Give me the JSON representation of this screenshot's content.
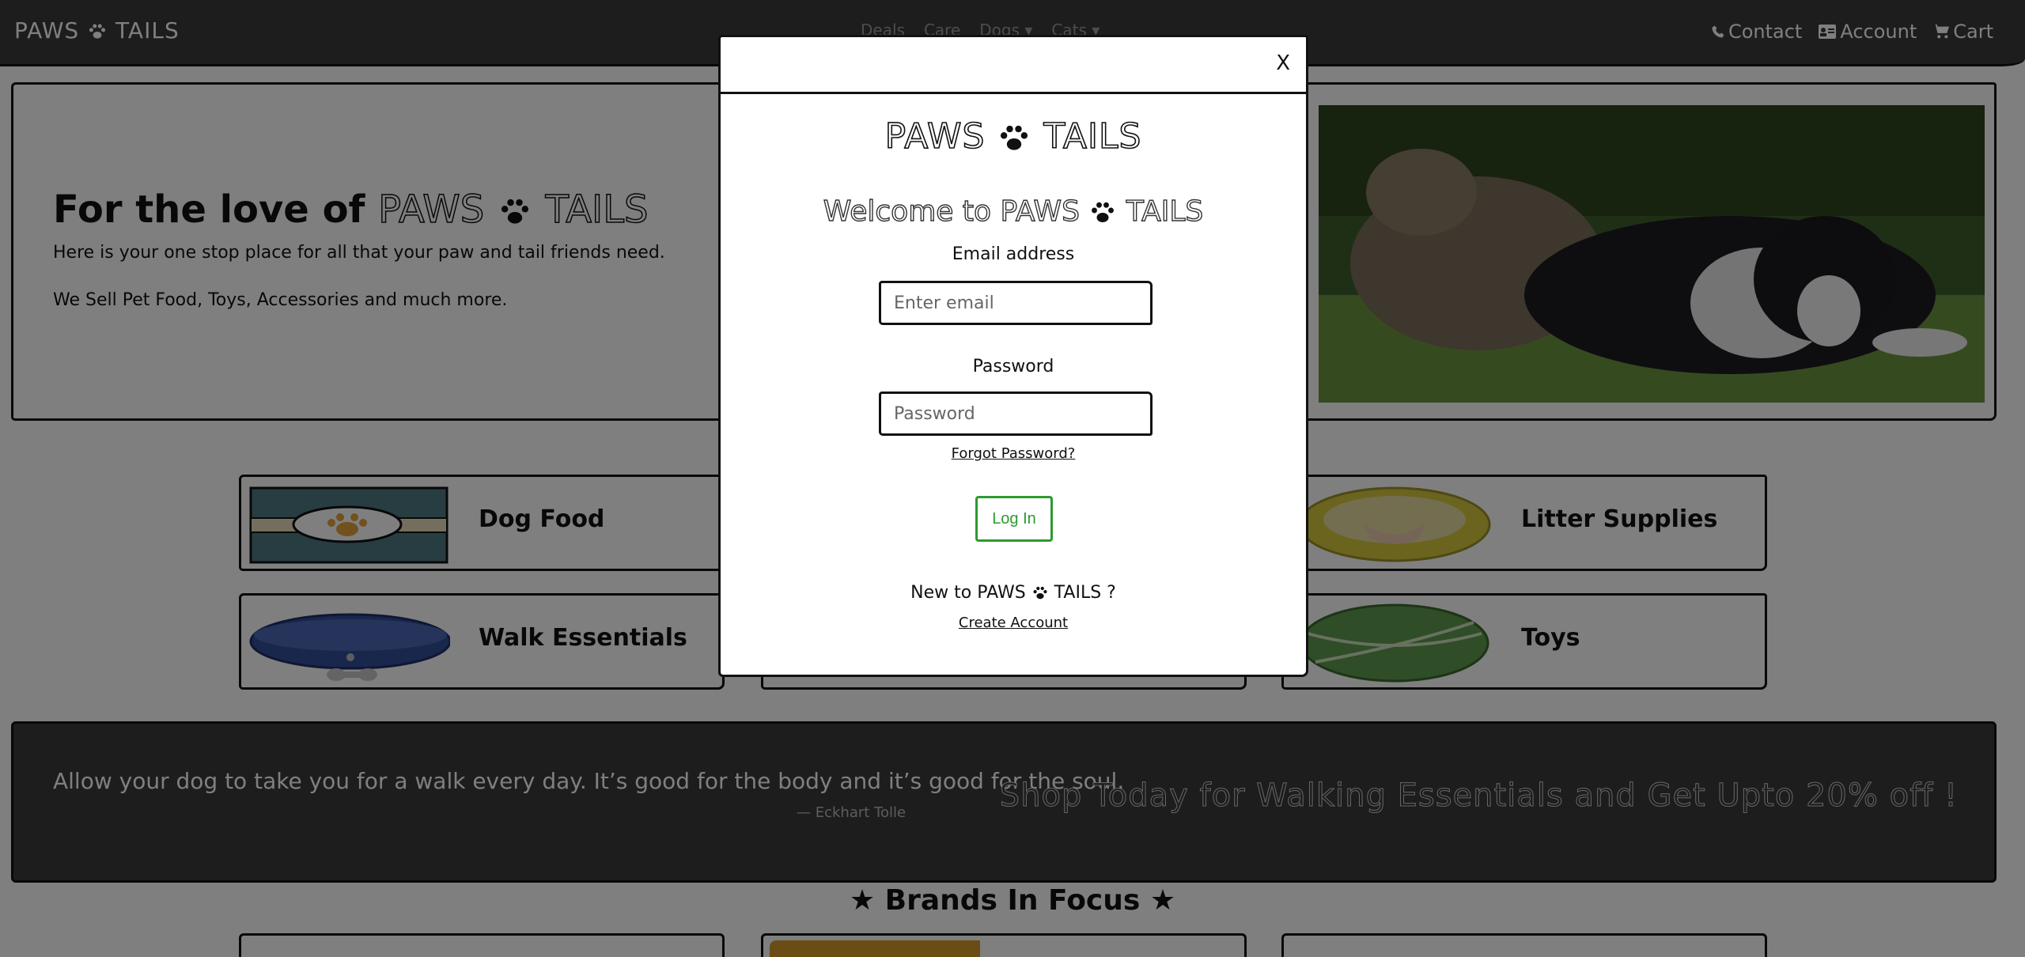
{
  "navbar": {
    "brand_left": "PAWS",
    "brand_right": "TAILS",
    "links": [
      "Deals",
      "Care",
      "Dogs ▾",
      "Cats ▾"
    ],
    "right_links": [
      {
        "label": "Contact",
        "icon": "phone-icon"
      },
      {
        "label": "Account",
        "icon": "account-card-icon"
      },
      {
        "label": "Cart",
        "icon": "cart-icon"
      }
    ]
  },
  "hero": {
    "title_prefix": "For the love of",
    "brand_left": "PAWS",
    "brand_right": "TAILS",
    "line1": "Here is your one stop place for all that your paw and tail friends need.",
    "line2": "We Sell Pet Food, Toys, Accessories and much more."
  },
  "categories": [
    {
      "label": "Dog Food"
    },
    {
      "label": "Litter Supplies"
    },
    {
      "label": "Walk Essentials"
    },
    {
      "label": "Toys"
    }
  ],
  "banner": {
    "quote": "Allow your dog to take you for a walk every day. It’s good for the body and it’s good for the soul.",
    "author": "— Eckhart Tolle",
    "promo": "Shop Today for Walking Essentials and Get Upto 20% off !"
  },
  "brands": {
    "title": "Brands In Focus"
  },
  "modal": {
    "close": "X",
    "logo_left": "PAWS",
    "logo_right": "TAILS",
    "welcome_prefix": "Welcome to",
    "welcome_left": "PAWS",
    "welcome_right": "TAILS",
    "email_label": "Email address",
    "email_placeholder": "Enter email",
    "password_label": "Password",
    "password_placeholder": "Password",
    "forgot": "Forgot Password?",
    "login": "Log In",
    "new_prefix": "New to",
    "new_left": "PAWS",
    "new_right": "TAILS ?",
    "create": "Create Account"
  },
  "colors": {
    "navbar_bg": "#3a3a3a",
    "login_green": "#2e9a2e",
    "overlay": "rgba(0,0,0,0.5)"
  }
}
